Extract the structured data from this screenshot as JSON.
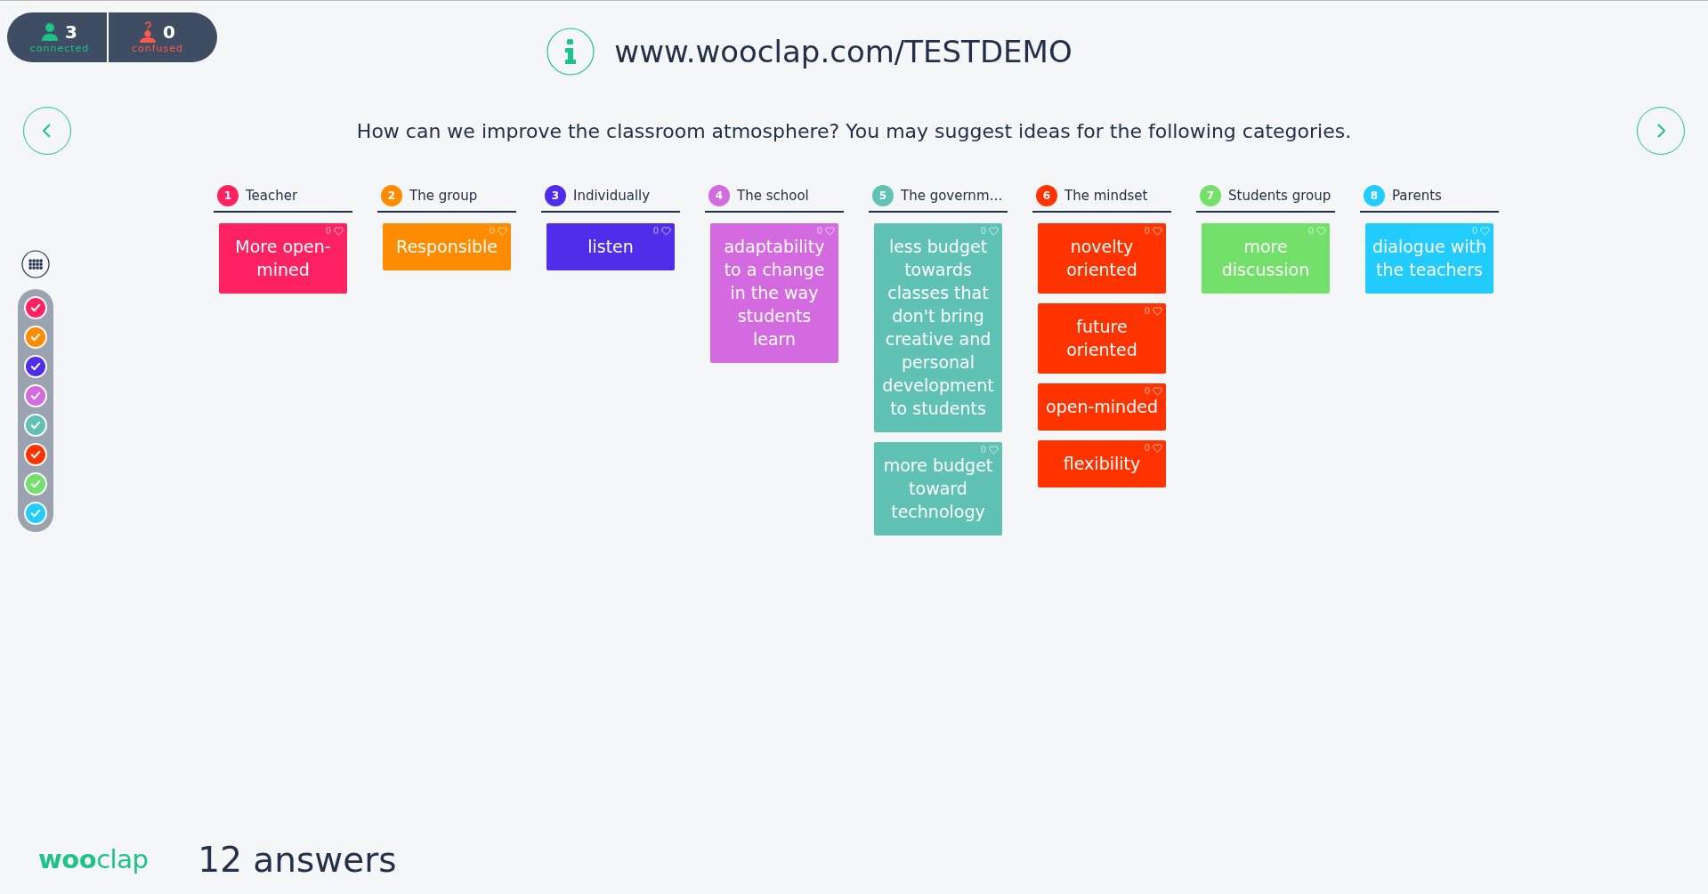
{
  "status": {
    "connected": {
      "count": "3",
      "label": "connected"
    },
    "confused": {
      "count": "0",
      "label": "confused"
    }
  },
  "url": "www.wooclap.com/TESTDEMO",
  "question": "How can we improve the classroom atmosphere? You may suggest ideas for the following categories.",
  "categories": [
    {
      "number": "1",
      "name": "Teacher",
      "color": "#ff2262",
      "checked": true,
      "cards": [
        {
          "text": "More open-mined",
          "likes": "0"
        }
      ]
    },
    {
      "number": "2",
      "name": "The group",
      "color": "#ff8c00",
      "checked": true,
      "cards": [
        {
          "text": "Responsible",
          "likes": "0"
        }
      ]
    },
    {
      "number": "3",
      "name": "Individually",
      "color": "#4f2deb",
      "checked": true,
      "cards": [
        {
          "text": "listen",
          "likes": "0"
        }
      ]
    },
    {
      "number": "4",
      "name": "The school",
      "color": "#d46adf",
      "checked": true,
      "cards": [
        {
          "text": "adaptability to a change in the way students learn",
          "likes": "0"
        }
      ]
    },
    {
      "number": "5",
      "name": "The governm…",
      "color": "#60c1b5",
      "checked": true,
      "cards": [
        {
          "text": "less budget towards classes that don't bring creative and personal development to students",
          "likes": "0"
        },
        {
          "text": "more budget toward technology",
          "likes": "0"
        }
      ]
    },
    {
      "number": "6",
      "name": "The mindset",
      "color": "#ff3300",
      "checked": true,
      "cards": [
        {
          "text": "novelty oriented",
          "likes": "0"
        },
        {
          "text": "future oriented",
          "likes": "0"
        },
        {
          "text": "open-minded",
          "likes": "0"
        },
        {
          "text": "flexibility",
          "likes": "0"
        }
      ]
    },
    {
      "number": "7",
      "name": "Students group",
      "color": "#72e06a",
      "checked": true,
      "cards": [
        {
          "text": "more discussion",
          "likes": "0"
        }
      ]
    },
    {
      "number": "8",
      "name": "Parents",
      "color": "#22ccff",
      "checked": true,
      "cards": [
        {
          "text": "dialogue with the teachers",
          "likes": "0"
        }
      ]
    }
  ],
  "footer": {
    "logo": "**woo**clap",
    "answers": "12 answers"
  }
}
